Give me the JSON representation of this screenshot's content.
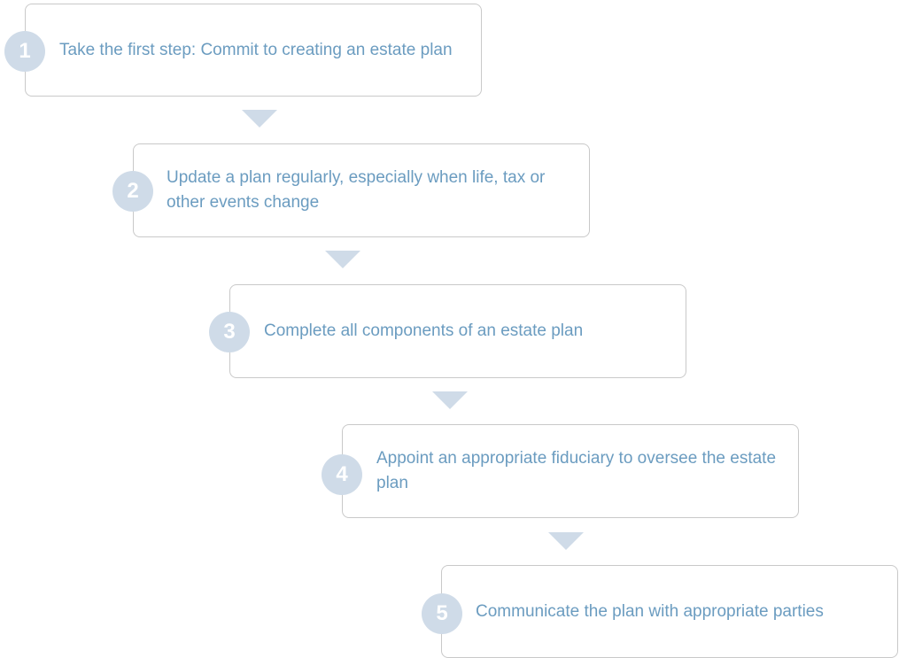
{
  "diagram": {
    "colors": {
      "text": "#6b9cc0",
      "accent": "#cfdbe8",
      "border": "#c9c9c9"
    },
    "steps": [
      {
        "number": "1",
        "text": "Take the first step: Commit to creating an estate plan"
      },
      {
        "number": "2",
        "text": "Update a plan regularly, especially when life, tax or other events change"
      },
      {
        "number": "3",
        "text": "Complete all components of an estate plan"
      },
      {
        "number": "4",
        "text": "Appoint an appropriate fiduciary to oversee the estate plan"
      },
      {
        "number": "5",
        "text": "Communicate the plan with appropriate parties"
      }
    ]
  }
}
